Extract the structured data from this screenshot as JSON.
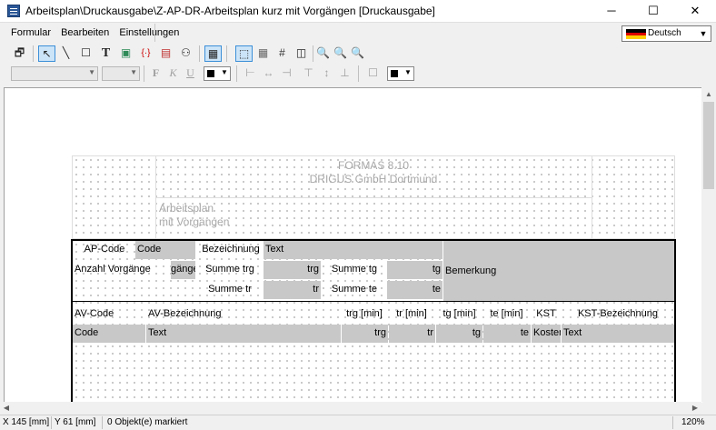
{
  "window": {
    "title": "Arbeitsplan\\Druckausgabe\\Z-AP-DR-Arbeitsplan kurz mit Vorgängen [Druckausgabe]",
    "minimize": "─",
    "maximize": "☐",
    "close": "✕"
  },
  "menu": {
    "items": [
      "Formular",
      "Bearbeiten",
      "Einstellungen"
    ]
  },
  "language": {
    "value": "Deutsch",
    "flag_colors": [
      "#000000",
      "#dd0000",
      "#ffce00"
    ]
  },
  "toolbar": {
    "fill_color_swatch": "#000000",
    "line_color_swatch": "#000000"
  },
  "form": {
    "header_line1": "FORMAS 8.10",
    "header_line2": "DRIGUS GmbH Dortmund",
    "subtitle1": "Arbeitsplan",
    "subtitle2": "mit Vorgängen",
    "ap_code_label": "AP-Code",
    "ap_code_value": "Code",
    "bezeichnung_label": "Bezeichnung",
    "bezeichnung_value": "Text",
    "anzahl_label": "Anzahl Vorgänge",
    "anzahl_value": "gänge",
    "summe_trg_label": "Summe trg",
    "summe_trg_value": "trg",
    "summe_tg_label": "Summe tg",
    "summe_tg_value": "tg",
    "bemerkung": "Bemerkung",
    "summe_tr_label": "Summe tr",
    "summe_tr_value": "tr",
    "summe_te_label": "Summe te",
    "summe_te_value": "te",
    "columns": [
      "AV-Code",
      "AV-Bezeichnung",
      "trg [min]",
      "tr [min]",
      "tg [min]",
      "te [min]",
      "KST",
      "KST-Bezeichnung"
    ],
    "row_values": [
      "Code",
      "Text",
      "trg",
      "tr",
      "tg",
      "te",
      "Kosten",
      "Text"
    ]
  },
  "status": {
    "x": "X 145 [mm]",
    "y": "Y 61 [mm]",
    "selection": "0 Objekt(e) markiert",
    "zoom": "120%"
  }
}
